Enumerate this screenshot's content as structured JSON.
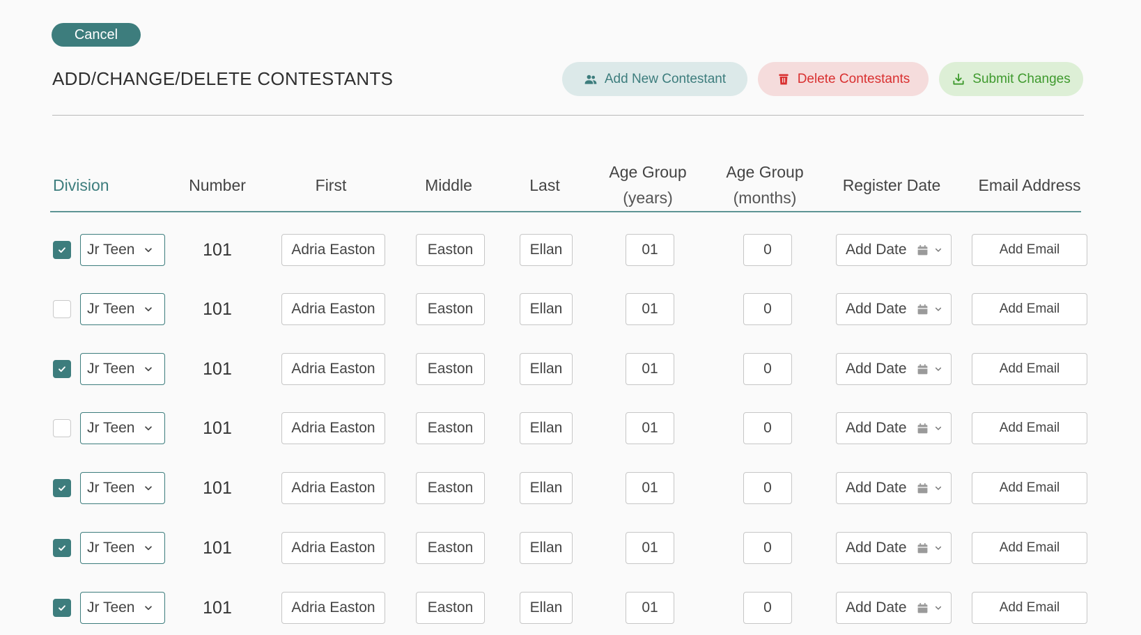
{
  "header": {
    "cancel_label": "Cancel",
    "title": "ADD/CHANGE/DELETE CONTESTANTS",
    "add_label": "Add New Contestant",
    "delete_label": "Delete Contestants",
    "submit_label": "Submit Changes"
  },
  "columns": {
    "division": "Division",
    "number": "Number",
    "first": "First",
    "middle": "Middle",
    "last": "Last",
    "age_years_title": "Age Group",
    "age_years_unit": "(years)",
    "age_months_title": "Age Group",
    "age_months_unit": "(months)",
    "register_date": "Register Date",
    "email": "Email Address"
  },
  "rows": [
    {
      "checked": true,
      "division": "Jr Teen",
      "number": "101",
      "first": "Adria Easton",
      "middle": "Easton",
      "last": "Ellan",
      "age_years": "01",
      "age_months": "0",
      "date_placeholder": "Add Date",
      "email_placeholder": "Add Email"
    },
    {
      "checked": false,
      "division": "Jr Teen",
      "number": "101",
      "first": "Adria Easton",
      "middle": "Easton",
      "last": "Ellan",
      "age_years": "01",
      "age_months": "0",
      "date_placeholder": "Add Date",
      "email_placeholder": "Add Email"
    },
    {
      "checked": true,
      "division": "Jr Teen",
      "number": "101",
      "first": "Adria Easton",
      "middle": "Easton",
      "last": "Ellan",
      "age_years": "01",
      "age_months": "0",
      "date_placeholder": "Add Date",
      "email_placeholder": "Add Email"
    },
    {
      "checked": false,
      "division": "Jr Teen",
      "number": "101",
      "first": "Adria Easton",
      "middle": "Easton",
      "last": "Ellan",
      "age_years": "01",
      "age_months": "0",
      "date_placeholder": "Add Date",
      "email_placeholder": "Add Email"
    },
    {
      "checked": true,
      "division": "Jr Teen",
      "number": "101",
      "first": "Adria Easton",
      "middle": "Easton",
      "last": "Ellan",
      "age_years": "01",
      "age_months": "0",
      "date_placeholder": "Add Date",
      "email_placeholder": "Add Email"
    },
    {
      "checked": true,
      "division": "Jr Teen",
      "number": "101",
      "first": "Adria Easton",
      "middle": "Easton",
      "last": "Ellan",
      "age_years": "01",
      "age_months": "0",
      "date_placeholder": "Add Date",
      "email_placeholder": "Add Email"
    },
    {
      "checked": true,
      "division": "Jr Teen",
      "number": "101",
      "first": "Adria Easton",
      "middle": "Easton",
      "last": "Ellan",
      "age_years": "01",
      "age_months": "0",
      "date_placeholder": "Add Date",
      "email_placeholder": "Add Email"
    }
  ],
  "icons": {
    "add": "add-users-icon",
    "delete": "trash-icon",
    "submit": "download-icon",
    "calendar": "calendar-icon",
    "chevron": "chevron-down-icon",
    "check": "checkmark-icon"
  },
  "colors": {
    "accent": "#3d7d7d",
    "danger": "#d93030",
    "success": "#3f9a2e"
  }
}
